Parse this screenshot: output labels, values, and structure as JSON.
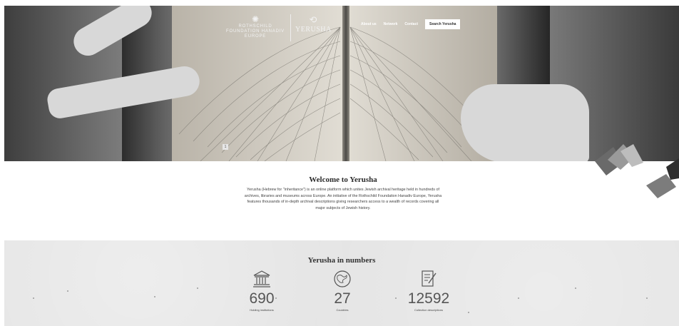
{
  "header": {
    "logo_rothschild": "ROTHSCHILD FOUNDATION HANADIV EUROPE",
    "logo_yerusha": "YERUSHA",
    "nav": [
      {
        "label": "About us"
      },
      {
        "label": "Network"
      },
      {
        "label": "Contact"
      }
    ],
    "search_button": "Search Yerusha"
  },
  "hero": {
    "slide_indicator": "1"
  },
  "welcome": {
    "title": "Welcome to Yerusha",
    "text": "Yerusha (Hebrew for \"inheritance\") is an online platform which unites Jewish archival heritage held in hundreds of archives, libraries and museums across Europe. An initiative of the Rothschild Foundation Hanadiv Europe, Yerusha features thousands of in-depth archival descriptions giving researchers access to a wealth of records covering all major subjects of Jewish history."
  },
  "numbers": {
    "title": "Yerusha in numbers",
    "stats": [
      {
        "value": "690",
        "label": "Holding institutions",
        "icon": "building-icon"
      },
      {
        "value": "27",
        "label": "Countries",
        "icon": "globe-icon"
      },
      {
        "value": "12592",
        "label": "Collection descriptions",
        "icon": "document-pen-icon"
      }
    ]
  }
}
